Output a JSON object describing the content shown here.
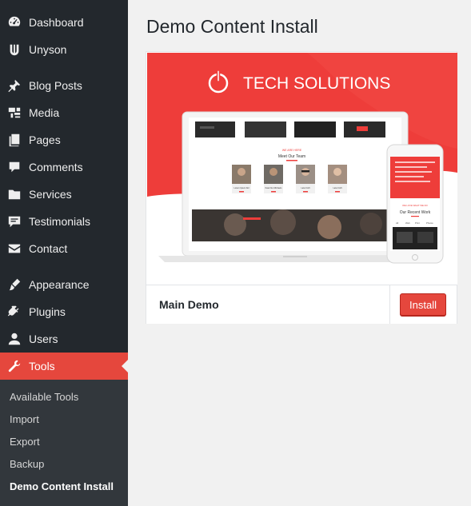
{
  "sidebar": {
    "items": [
      {
        "label": "Dashboard",
        "icon": "dashboard-icon"
      },
      {
        "label": "Unyson",
        "icon": "unyson-icon"
      },
      {
        "label": "Blog Posts",
        "icon": "pin-icon"
      },
      {
        "label": "Media",
        "icon": "media-icon"
      },
      {
        "label": "Pages",
        "icon": "pages-icon"
      },
      {
        "label": "Comments",
        "icon": "comments-icon"
      },
      {
        "label": "Services",
        "icon": "folder-icon"
      },
      {
        "label": "Testimonials",
        "icon": "testimonials-icon"
      },
      {
        "label": "Contact",
        "icon": "envelope-icon"
      },
      {
        "label": "Appearance",
        "icon": "brush-icon"
      },
      {
        "label": "Plugins",
        "icon": "plug-icon"
      },
      {
        "label": "Users",
        "icon": "user-icon"
      },
      {
        "label": "Tools",
        "icon": "wrench-icon",
        "active": true
      }
    ],
    "submenu": [
      {
        "label": "Available Tools"
      },
      {
        "label": "Import"
      },
      {
        "label": "Export"
      },
      {
        "label": "Backup"
      },
      {
        "label": "Demo Content Install",
        "current": true
      }
    ]
  },
  "main": {
    "title": "Demo Content Install",
    "demo": {
      "preview": {
        "brand": "TECH SOLUTIONS",
        "section_small": "WE ARE HERE",
        "section_title": "Meet Our Team",
        "team": [
          {
            "name": "Lorem Ipsum Dol"
          },
          {
            "name": "Kate Fire Michaels"
          },
          {
            "name": "Lara Croft"
          },
          {
            "name": "Lara Croft"
          }
        ],
        "mobile_small": "WE LOVE WHAT WE DO",
        "mobile_title": "Our Recent Work",
        "mobile_tabs": [
          "All",
          "Web",
          "Print",
          "Photos"
        ]
      },
      "name": "Main Demo",
      "install_label": "Install"
    }
  },
  "colors": {
    "accent": "#e5473d",
    "sidebar_bg": "#23282d",
    "submenu_bg": "#32373c"
  }
}
